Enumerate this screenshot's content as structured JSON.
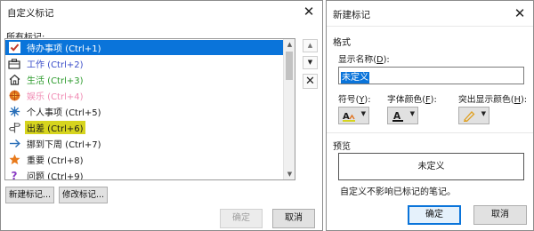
{
  "customize_dialog": {
    "title": "自定义标记",
    "all_tags_label": "所有标记:",
    "items": [
      {
        "label": "待办事项 (Ctrl+1)",
        "color": "#ffffff",
        "icon": "checkbox-icon"
      },
      {
        "label": "工作 (Ctrl+2)",
        "color": "#3a4dc9",
        "icon": "briefcase-icon"
      },
      {
        "label": "生活 (Ctrl+3)",
        "color": "#2b9a2b",
        "icon": "home-icon"
      },
      {
        "label": "娱乐 (Ctrl+4)",
        "color": "#f08cb4",
        "icon": "puzzle-icon"
      },
      {
        "label": "个人事项 (Ctrl+5)",
        "color": "#1a1a1a",
        "icon": "person-icon"
      },
      {
        "label": "出差 (Ctrl+6)",
        "color": "#1a1a1a",
        "icon": "direction-sign-icon",
        "highlight": "#d6d41e"
      },
      {
        "label": "挪到下周 (Ctrl+7)",
        "color": "#1a1a1a",
        "icon": "arrow-right-icon"
      },
      {
        "label": "重要 (Ctrl+8)",
        "color": "#1a1a1a",
        "icon": "star-icon"
      },
      {
        "label": "问题 (Ctrl+9)",
        "color": "#1a1a1a",
        "icon": "question-icon"
      }
    ],
    "new_tag_button": "新建标记...",
    "modify_tag_button": "修改标记...",
    "ok_button": "确定",
    "cancel_button": "取消"
  },
  "new_tag_dialog": {
    "title": "新建标记",
    "format_label": "格式",
    "display_name_label": "显示名称",
    "display_name_key": "D",
    "display_name_value": "未定义",
    "symbol_label": "符号",
    "symbol_key": "Y",
    "font_color_label": "字体颜色",
    "font_color_key": "F",
    "highlight_label": "突出显示颜色",
    "highlight_key": "H",
    "preview_label": "预览",
    "preview_text": "未定义",
    "note": "自定义不影响已标记的笔记。",
    "ok_button": "确定",
    "cancel_button": "取消"
  },
  "colors": {
    "selection_blue": "#0a74da",
    "highlight_yellow": "#d6d41e"
  }
}
